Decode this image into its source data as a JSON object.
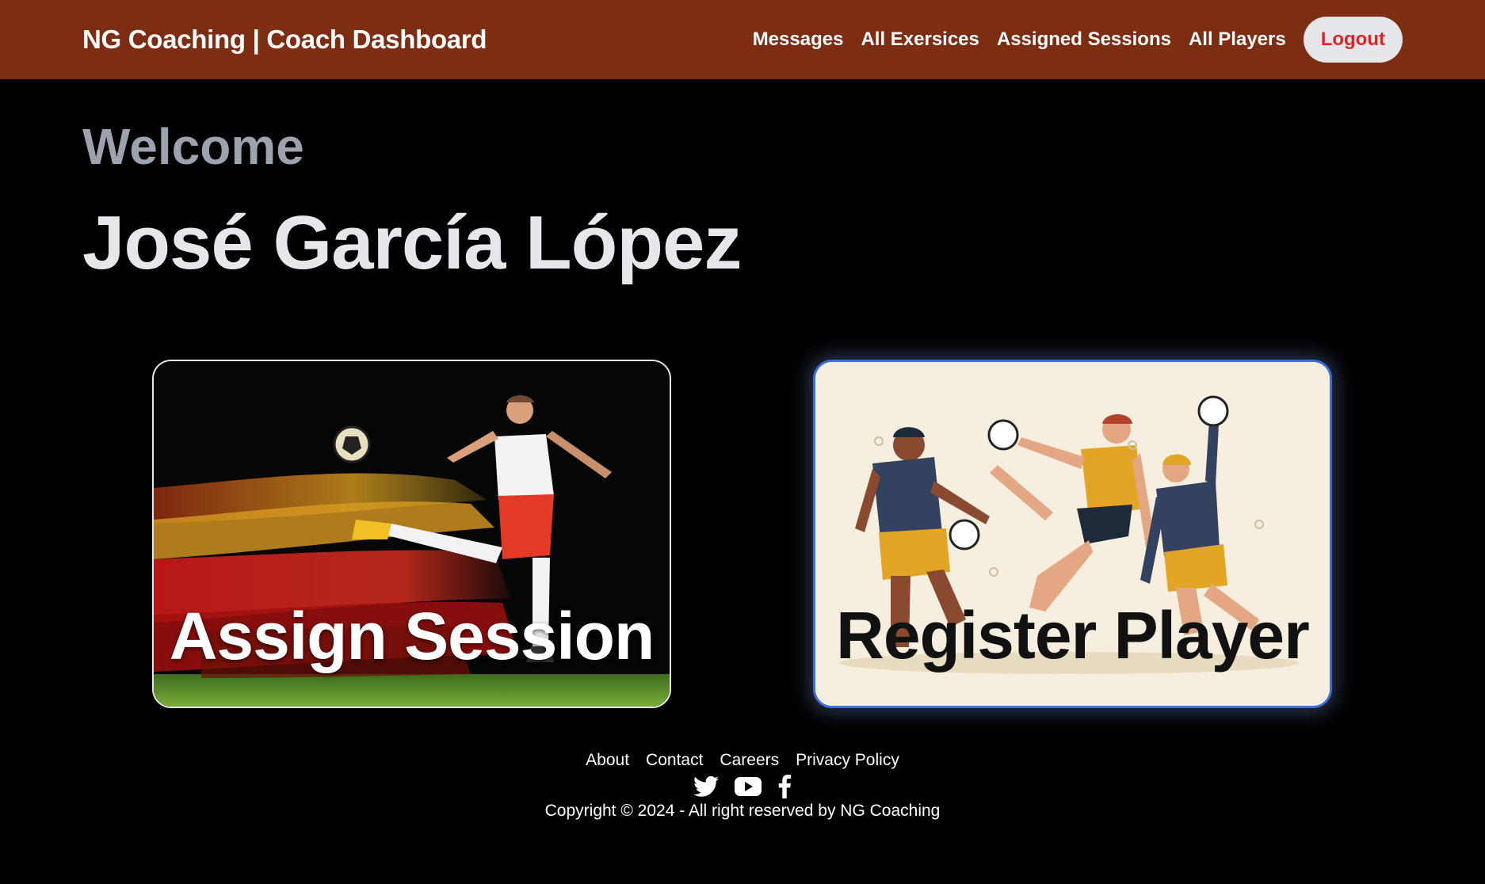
{
  "header": {
    "brand": "NG Coaching | Coach Dashboard",
    "nav": {
      "messages": "Messages",
      "exercises": "All Exersices",
      "sessions": "Assigned Sessions",
      "players": "All Players"
    },
    "logout": "Logout"
  },
  "welcome": {
    "greeting": "Welcome",
    "user_name": "José García López"
  },
  "cards": {
    "assign": {
      "title": "Assign Session"
    },
    "register": {
      "title": "Register Player"
    }
  },
  "footer": {
    "links": {
      "about": "About",
      "contact": "Contact",
      "careers": "Careers",
      "privacy": "Privacy Policy"
    },
    "socials": [
      "twitter-icon",
      "youtube-icon",
      "facebook-icon"
    ],
    "copyright": "Copyright © 2024 - All right reserved by NG Coaching"
  },
  "colors": {
    "header_bg": "#7c2d12",
    "logout_text": "#dc2626",
    "card_border_active": "#3b6fd8"
  }
}
